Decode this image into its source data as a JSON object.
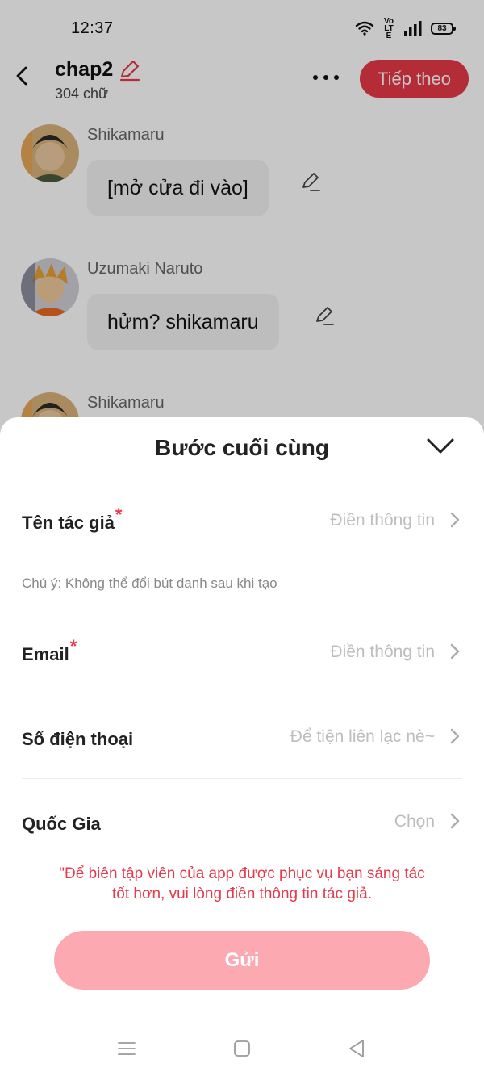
{
  "status_bar": {
    "time": "12:37",
    "network_label": "Vo LTE",
    "battery": "83"
  },
  "header": {
    "title": "chap2",
    "word_count": "304 chữ",
    "next_button": "Tiếp theo",
    "icons": [
      "back-arrow-icon",
      "pencil-icon",
      "more-dots-icon"
    ],
    "accent_color": "#e8394a"
  },
  "chat": {
    "messages": [
      {
        "speaker": "Shikamaru",
        "text": "[mở cửa đi vào]",
        "avatar": "shikamaru-avatar"
      },
      {
        "speaker": "Uzumaki Naruto",
        "text": "hửm? shikamaru",
        "avatar": "naruto-avatar"
      },
      {
        "speaker": "Shikamaru",
        "text": "",
        "avatar": "shikamaru-avatar"
      }
    ]
  },
  "sheet": {
    "title": "Bước cuối cùng",
    "fields": [
      {
        "label": "Tên tác giả",
        "required": "*",
        "placeholder": "Điền thông tin"
      },
      {
        "label": "Email",
        "required": "*",
        "placeholder": "Điền thông tin"
      },
      {
        "label": "Số điện thoại",
        "required": "",
        "placeholder": "Để tiện liên lạc nè~"
      },
      {
        "label": "Quốc Gia",
        "required": "",
        "placeholder": "Chọn"
      }
    ],
    "author_note": "Chú ý: Không thể đổi bút danh sau khi tạo",
    "hint_line1": "\"Để biên tập viên của app được phục vụ bạn sáng tác",
    "hint_line2": "tốt hơn, vui lòng điền thông tin tác giả.",
    "submit_button": "Gửi",
    "submit_color": "#fda9b2"
  },
  "nav_bar": {
    "icons": [
      "menu-icon",
      "home-square-icon",
      "back-triangle-icon"
    ]
  }
}
